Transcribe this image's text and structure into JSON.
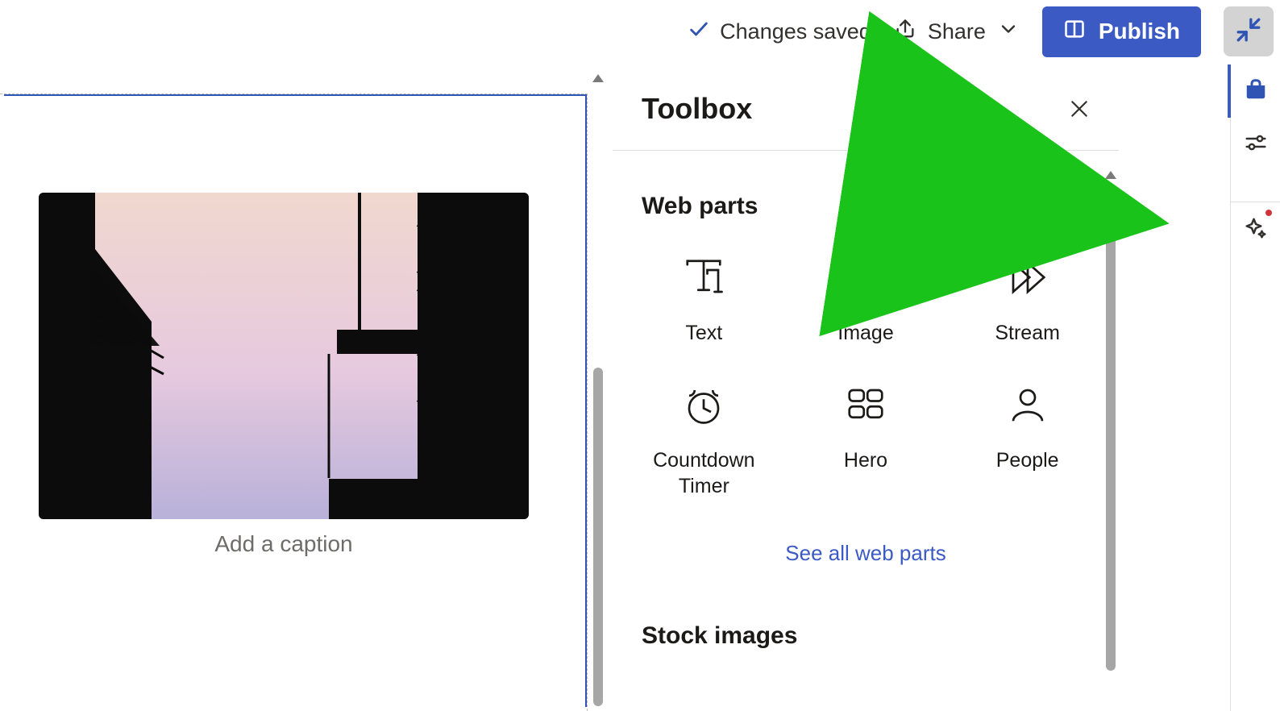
{
  "topbar": {
    "status_text": "Changes saved",
    "share_label": "Share",
    "publish_label": "Publish"
  },
  "canvas": {
    "caption_placeholder": "Add a caption"
  },
  "toolbox": {
    "title": "Toolbox",
    "sections": {
      "web_parts": {
        "heading": "Web parts",
        "see_all": "See all web parts",
        "items": [
          {
            "label": "Text",
            "icon": "text-icon"
          },
          {
            "label": "Image",
            "icon": "image-icon"
          },
          {
            "label": "Stream",
            "icon": "stream-icon"
          },
          {
            "label": "Countdown\nTimer",
            "icon": "countdown-timer-icon"
          },
          {
            "label": "Hero",
            "icon": "hero-icon"
          },
          {
            "label": "People",
            "icon": "people-icon"
          }
        ]
      },
      "stock_images": {
        "heading": "Stock images"
      }
    }
  },
  "rail": {
    "items": [
      {
        "name": "toolbox",
        "active": true
      },
      {
        "name": "settings"
      },
      {
        "name": "copilot",
        "badge": true
      }
    ]
  },
  "colors": {
    "primary": "#3054b3",
    "annotation": "#19c319"
  }
}
